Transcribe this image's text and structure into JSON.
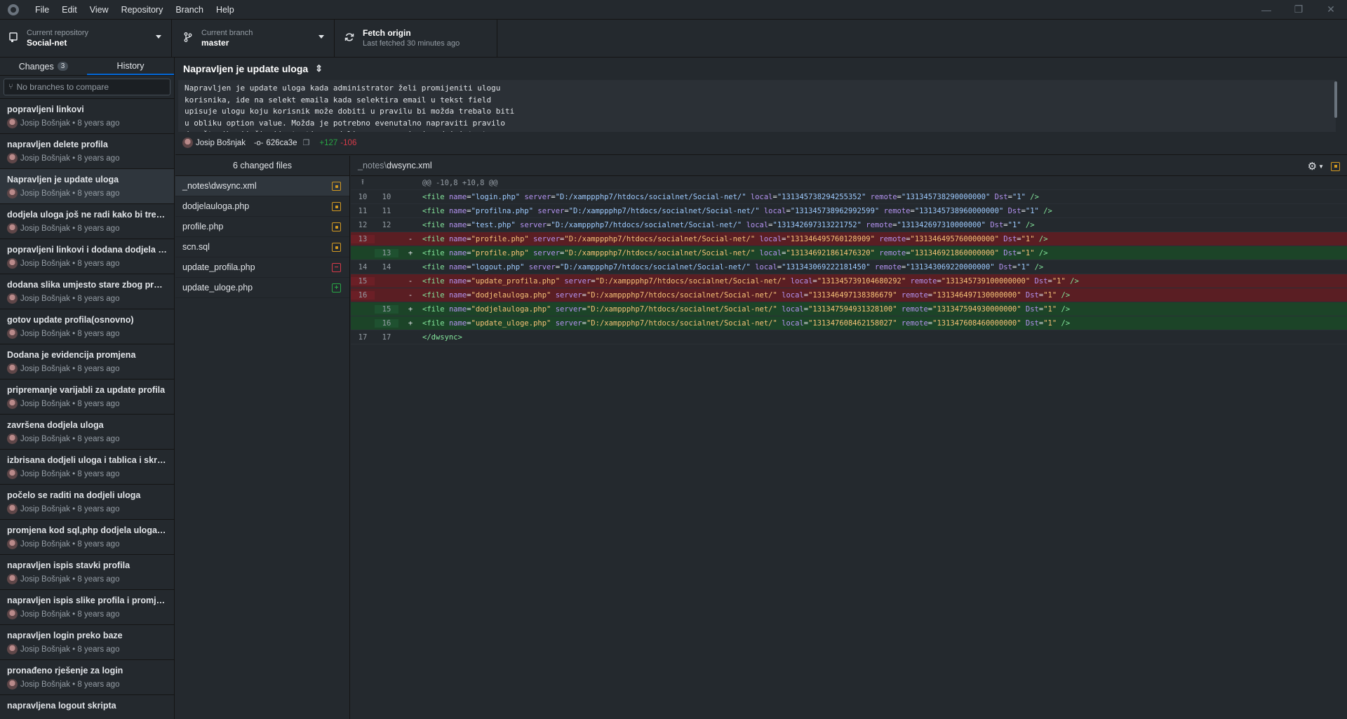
{
  "menu": [
    "File",
    "Edit",
    "View",
    "Repository",
    "Branch",
    "Help"
  ],
  "window_controls": {
    "minimize": "—",
    "restore": "❐",
    "close": "✕"
  },
  "toolbar": {
    "repo_label": "Current repository",
    "repo_value": "Social-net",
    "branch_label": "Current branch",
    "branch_value": "master",
    "fetch_label": "Fetch origin",
    "fetch_sub": "Last fetched 30 minutes ago"
  },
  "sidebar": {
    "tab_changes": "Changes",
    "changes_count": "3",
    "tab_history": "History",
    "compare_placeholder": "No branches to compare",
    "commits": [
      {
        "title": "popravljeni linkovi",
        "author": "Josip Bošnjak • 8 years ago"
      },
      {
        "title": "napravljen delete profila",
        "author": "Josip Bošnjak • 8 years ago"
      },
      {
        "title": "Napravljen je update uloga",
        "author": "Josip Bošnjak • 8 years ago"
      },
      {
        "title": "dodjela uloga još ne radi kako bi trebalo",
        "author": "Josip Bošnjak • 8 years ago"
      },
      {
        "title": "popravljeni linkovi i dodana dodjela ul...",
        "author": "Josip Bošnjak • 8 years ago"
      },
      {
        "title": "dodana slika umjesto stare zbog pregle...",
        "author": "Josip Bošnjak • 8 years ago"
      },
      {
        "title": "gotov update profila(osnovno)",
        "author": "Josip Bošnjak • 8 years ago"
      },
      {
        "title": "Dodana je evidencija promjena",
        "author": "Josip Bošnjak • 8 years ago"
      },
      {
        "title": "pripremanje varijabli za update profila",
        "author": "Josip Bošnjak • 8 years ago"
      },
      {
        "title": "završena dodjela uloga",
        "author": "Josip Bošnjak • 8 years ago"
      },
      {
        "title": "izbrisana dodjeli uloga i tablica i skripta",
        "author": "Josip Bošnjak • 8 years ago"
      },
      {
        "title": "počelo se raditi na dodjeli uloga",
        "author": "Josip Bošnjak • 8 years ago"
      },
      {
        "title": "promjena kod sql,php dodjela uloga i css",
        "author": "Josip Bošnjak • 8 years ago"
      },
      {
        "title": "napravljen ispis stavki profila",
        "author": "Josip Bošnjak • 8 years ago"
      },
      {
        "title": "napravljen ispis slike profila i promjena...",
        "author": "Josip Bošnjak • 8 years ago"
      },
      {
        "title": "napravljen login preko baze",
        "author": "Josip Bošnjak • 8 years ago"
      },
      {
        "title": "pronađeno rješenje za login",
        "author": "Josip Bošnjak • 8 years ago"
      },
      {
        "title": "napravljena logout skripta",
        "author": ""
      }
    ]
  },
  "commit": {
    "title": "Napravljen je update uloga",
    "body": "Napravljen je update uloga kada administrator želi promijeniti ulogu\nkorisnika, ide na selekt emaila kada selektira email u tekst field\nupisuje ulogu koju korisnik može dobiti u pravilu bi možda trebalo biti\nu obliku option value. Možda je potrebno evenutalno napraviti pravilo\ndopuštenih riječi nije testirano dali se samo upisuje administrator",
    "author": "Josip Bošnjak",
    "sha": "626ca3e",
    "additions": "+127",
    "deletions": "-106"
  },
  "files": {
    "header": "6 changed files",
    "items": [
      {
        "name": "_notes\\dwsync.xml",
        "status": "modified"
      },
      {
        "name": "dodjelauloga.php",
        "status": "modified"
      },
      {
        "name": "profile.php",
        "status": "modified"
      },
      {
        "name": "scn.sql",
        "status": "modified"
      },
      {
        "name": "update_profila.php",
        "status": "deleted"
      },
      {
        "name": "update_uloge.php",
        "status": "added"
      }
    ]
  },
  "diff": {
    "path_dir": "_notes\\",
    "path_file": "dwsync.xml",
    "hunk": "@@ -10,8 +10,8 @@",
    "lines": [
      {
        "type": "ctx",
        "old": "10",
        "new": "10",
        "mark": "",
        "name": "login.php",
        "server": "D:/xamppphp7/htdocs/socialnet/Social-net/",
        "local": "131345738294255352",
        "remote": "131345738290000000"
      },
      {
        "type": "ctx",
        "old": "11",
        "new": "11",
        "mark": "",
        "name": "profilna.php",
        "server": "D:/xamppphp7/htdocs/socialnet/Social-net/",
        "local": "131345738962992599",
        "remote": "131345738960000000"
      },
      {
        "type": "ctx",
        "old": "12",
        "new": "12",
        "mark": "",
        "name": "test.php",
        "server": "D:/xamppphp7/htdocs/socialnet/Social-net/",
        "local": "131342697313221752",
        "remote": "131342697310000000"
      },
      {
        "type": "del",
        "old": "13",
        "new": "",
        "mark": "-",
        "name": "profile.php",
        "server": "D:/xamppphp7/htdocs/socialnet/Social-net/",
        "local": "131346495760128909",
        "remote": "131346495760000000"
      },
      {
        "type": "add",
        "old": "",
        "new": "13",
        "mark": "+",
        "name": "profile.php",
        "server": "D:/xamppphp7/htdocs/socialnet/Social-net/",
        "local": "131346921861476320",
        "remote": "131346921860000000"
      },
      {
        "type": "ctx",
        "old": "14",
        "new": "14",
        "mark": "",
        "name": "logout.php",
        "server": "D:/xamppphp7/htdocs/socialnet/Social-net/",
        "local": "131343069222181450",
        "remote": "131343069220000000"
      },
      {
        "type": "del",
        "old": "15",
        "new": "",
        "mark": "-",
        "name": "update_profila.php",
        "server": "D:/xamppphp7/htdocs/socialnet/Social-net/",
        "local": "131345739104680292",
        "remote": "131345739100000000"
      },
      {
        "type": "del",
        "old": "16",
        "new": "",
        "mark": "-",
        "name": "dodjelauloga.php",
        "server": "D:/xamppphp7/htdocs/socialnet/Social-net/",
        "local": "131346497138386679",
        "remote": "131346497130000000"
      },
      {
        "type": "add",
        "old": "",
        "new": "15",
        "mark": "+",
        "name": "dodjelauloga.php",
        "server": "D:/xamppphp7/htdocs/socialnet/Social-net/",
        "local": "131347594931328100",
        "remote": "131347594930000000"
      },
      {
        "type": "add",
        "old": "",
        "new": "16",
        "mark": "+",
        "name": "update_uloge.php",
        "server": "D:/xamppphp7/htdocs/socialnet/Social-net/",
        "local": "131347608462158027",
        "remote": "131347608460000000"
      }
    ],
    "closing": {
      "old": "17",
      "new": "17",
      "text": "</dwsync>"
    }
  },
  "icons": {
    "repo": "repo-icon",
    "branch": "branch-icon",
    "fetch": "sync-icon",
    "settings": "gear-icon",
    "expand": "expand-hunk-icon"
  }
}
